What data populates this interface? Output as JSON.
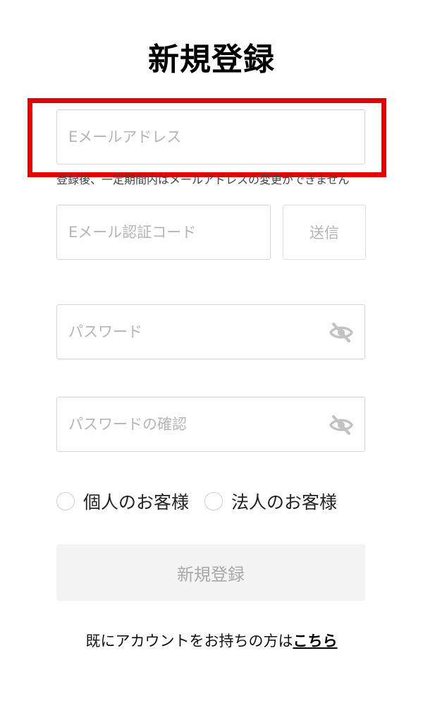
{
  "page_title": "新規登録",
  "email": {
    "placeholder": "Eメールアドレス",
    "hint": "登録後、一定期間内はメールアドレスの変更ができません"
  },
  "verification": {
    "placeholder": "Eメール認証コード",
    "send_label": "送信"
  },
  "password": {
    "placeholder": "パスワード",
    "icon": "eye-off-icon"
  },
  "password_confirm": {
    "placeholder": "パスワードの確認",
    "icon": "eye-off-icon"
  },
  "account_type": {
    "options": [
      "個人のお客様",
      "法人のお客様"
    ]
  },
  "submit_label": "新規登録",
  "login": {
    "prompt": "既にアカウントをお持ちの方は",
    "link_label": "こちら"
  },
  "colors": {
    "highlight": "#e60000",
    "border": "#d6d6d6",
    "placeholder": "#b5b5b5",
    "disabled_button_bg": "#f3f3f3"
  }
}
